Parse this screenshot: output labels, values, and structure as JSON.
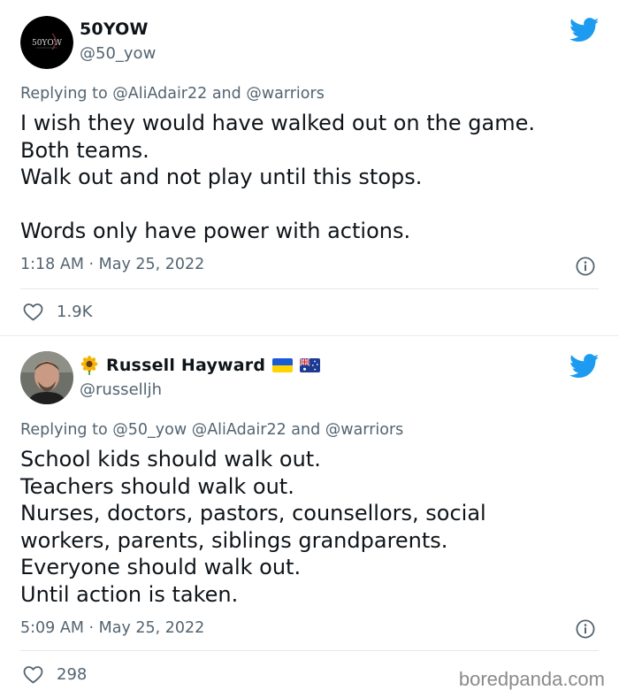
{
  "colors": {
    "twitter_blue": "#1d9bf0",
    "text_primary": "#0f1419",
    "text_secondary": "#536471",
    "divider": "#e6ecf0"
  },
  "tweets": [
    {
      "display_name": "50YOW",
      "handle": "@50_yow",
      "avatar_text": "50YOW",
      "replying_prefix": "Replying to",
      "replying_to": "@AliAdair22 and @warriors",
      "body": "I wish they would have walked out on the game.\nBoth teams.\nWalk out and not play until this stops.\n\nWords only have power with actions.",
      "timestamp": "1:18 AM · May 25, 2022",
      "likes": "1.9K",
      "icons": [
        "twitter-bird-icon",
        "info-icon",
        "heart-icon"
      ]
    },
    {
      "display_name": "Russell Hayward",
      "handle": "@russelljh",
      "name_emoji": [
        "sunflower-icon",
        "ukraine-flag-icon",
        "australia-flag-icon"
      ],
      "replying_prefix": "Replying to",
      "replying_to": "@50_yow @AliAdair22 and @warriors",
      "body": "School kids should walk out.\nTeachers should walk out.\nNurses, doctors, pastors, counsellors, social\nworkers, parents, siblings grandparents.\nEveryone should walk out.\nUntil action is taken.",
      "timestamp": "5:09 AM · May 25, 2022",
      "likes": "298",
      "icons": [
        "twitter-bird-icon",
        "info-icon",
        "heart-icon"
      ]
    }
  ],
  "watermark": "boredpanda.com"
}
